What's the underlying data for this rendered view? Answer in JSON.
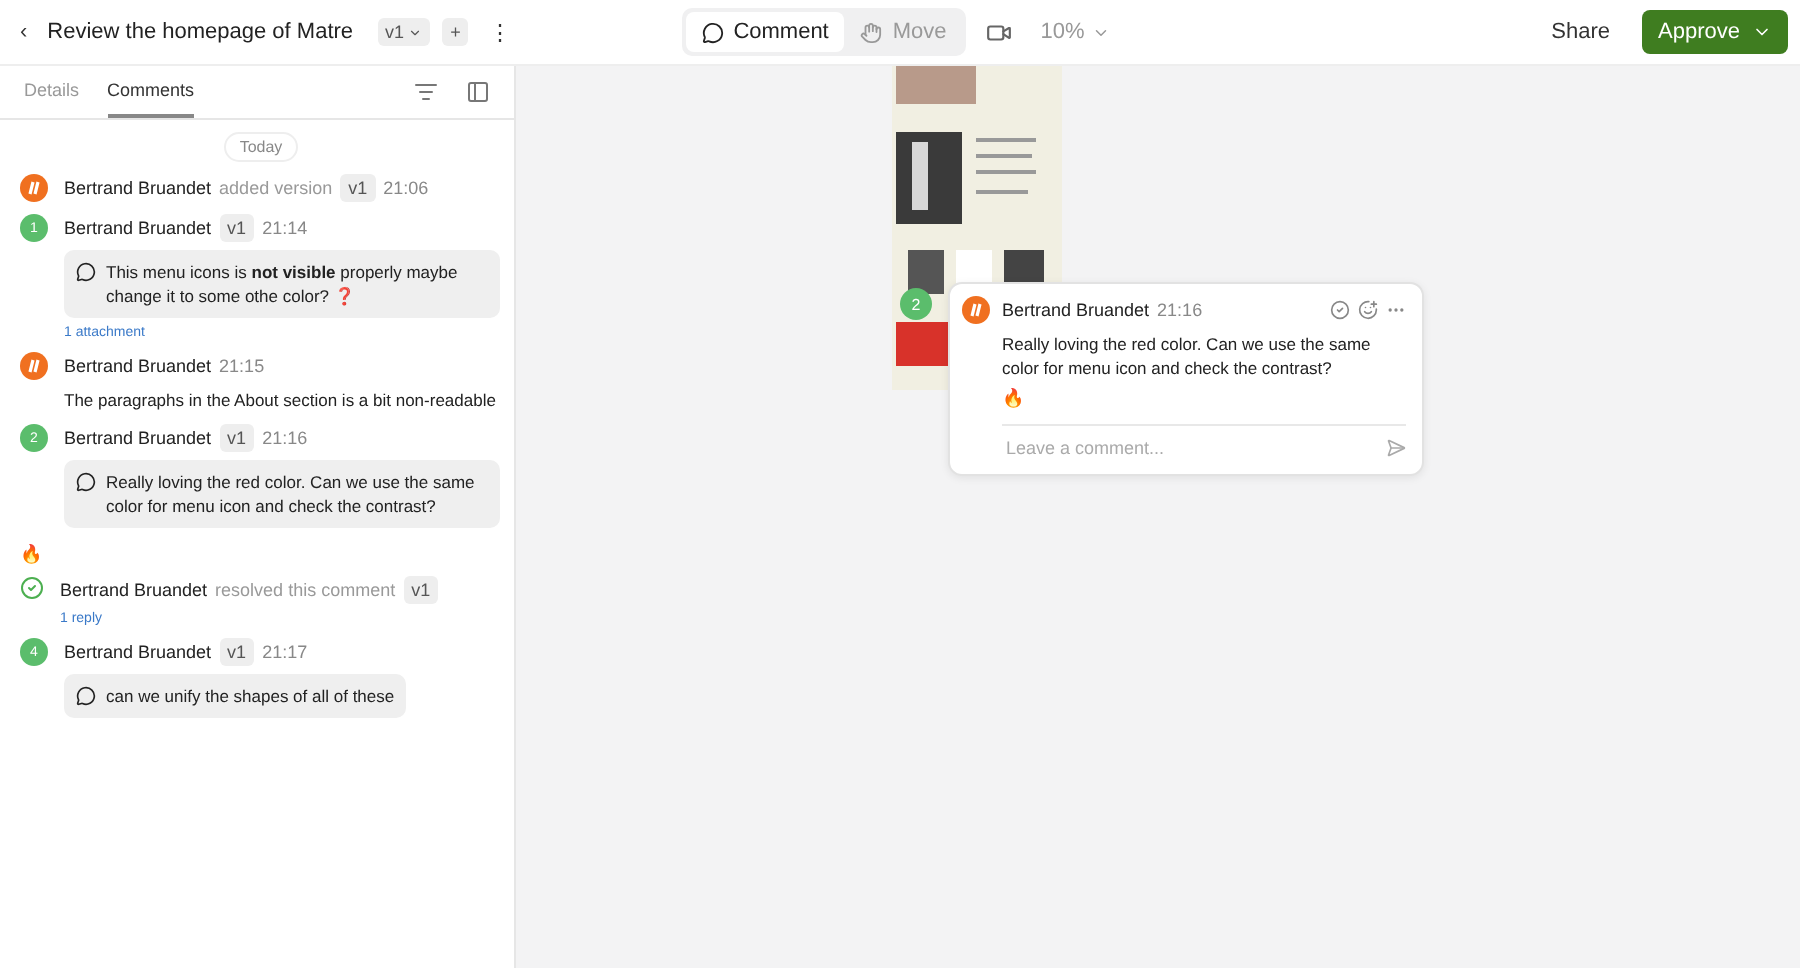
{
  "header": {
    "back": "‹",
    "title": "Review the homepage of Matre",
    "version": "v1",
    "add": "+",
    "more": "⋮"
  },
  "toolbar": {
    "tools": [
      {
        "label": "Comment",
        "selected": true
      },
      {
        "label": "Move",
        "selected": false
      }
    ],
    "zoom": "10%"
  },
  "actions": {
    "share": "Share",
    "approve": "Approve"
  },
  "sidebar": {
    "tabs": [
      {
        "label": "Details",
        "selected": false
      },
      {
        "label": "Comments",
        "selected": true
      }
    ],
    "day": "Today",
    "entries": [
      {
        "kind": "event",
        "author": "Bertrand Bruandet",
        "action": "added version",
        "version": "v1",
        "time": "21:06"
      },
      {
        "kind": "comment",
        "marker": "1",
        "author": "Bertrand Bruandet",
        "version": "v1",
        "time": "21:14",
        "text": "This menu icons is **not visible** properly maybe change it to some othe color? ❓",
        "link": "1 attachment"
      },
      {
        "kind": "reply",
        "author": "Bertrand Bruandet",
        "time": "21:15",
        "text": "The paragraphs in the About section is a bit non-readable"
      },
      {
        "kind": "comment",
        "marker": "2",
        "author": "Bertrand Bruandet",
        "version": "v1",
        "time": "21:16",
        "text": "Really loving the red color. Can we use the same color for menu icon and check the contrast?",
        "reaction": "🔥"
      },
      {
        "kind": "resolved",
        "author": "Bertrand Bruandet",
        "action": "resolved this comment",
        "version": "v1",
        "link": "1 reply"
      },
      {
        "kind": "comment",
        "marker": "4",
        "author": "Bertrand Bruandet",
        "version": "v1",
        "time": "21:17",
        "text": "can we unify the shapes of all of these"
      }
    ]
  },
  "popup": {
    "marker": "2",
    "author": "Bertrand Bruandet",
    "time": "21:16",
    "text": "Really loving the red color. Can we use the same color for menu icon and check the contrast?",
    "reaction": "🔥",
    "placeholder": "Leave a comment..."
  }
}
